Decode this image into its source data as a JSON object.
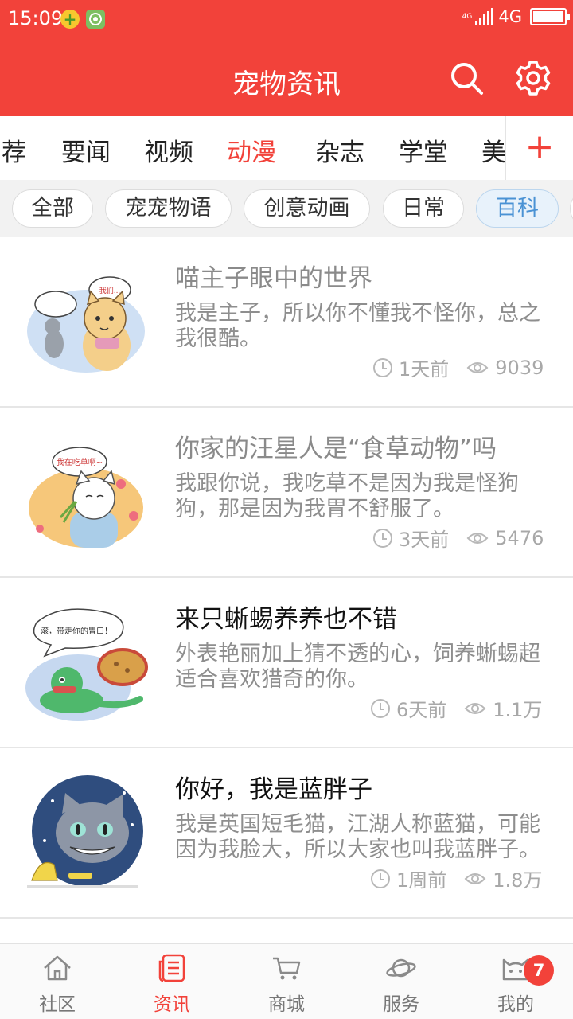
{
  "status_bar": {
    "time": "15:09",
    "network_small": "4G",
    "network": "4G"
  },
  "header": {
    "title": "宠物资讯",
    "icons": {
      "search": "search-icon",
      "settings": "gear-icon"
    }
  },
  "channels": {
    "items": [
      "荐",
      "要闻",
      "视频",
      "动漫",
      "杂志",
      "学堂",
      "美"
    ],
    "active": "动漫",
    "add_label": "+"
  },
  "subtabs": {
    "items": [
      "全部",
      "宠宠物语",
      "创意动画",
      "日常",
      "百科"
    ],
    "active": "百科"
  },
  "articles": [
    {
      "title": "喵主子眼中的世界",
      "desc": "我是主子，所以你不懂我不怪你，总之我很酷。",
      "time": "1天前",
      "views": "9039",
      "read": true,
      "image": "cartoon-cat-mouse"
    },
    {
      "title": "你家的汪星人是“食草动物”吗",
      "desc": "我跟你说，我吃草不是因为我是怪狗狗，那是因为我胃不舒服了。",
      "time": "3天前",
      "views": "5476",
      "read": true,
      "image": "cartoon-dog-eating-grass"
    },
    {
      "title": "来只蜥蜴养养也不错",
      "desc": "外表艳丽加上猜不透的心，饲养蜥蜴超适合喜欢猎奇的你。",
      "time": "6天前",
      "views": "1.1万",
      "read": false,
      "image": "cartoon-lizard"
    },
    {
      "title": "你好，我是蓝胖子",
      "desc": "我是英国短毛猫，江湖人称蓝猫，可能因为我脸大，所以大家也叫我蓝胖子。",
      "time": "1周前",
      "views": "1.8万",
      "read": false,
      "image": "cartoon-blue-cat"
    }
  ],
  "bottom_nav": {
    "items": [
      {
        "label": "社区",
        "icon": "home-icon"
      },
      {
        "label": "资讯",
        "icon": "news-icon"
      },
      {
        "label": "商城",
        "icon": "cart-icon"
      },
      {
        "label": "服务",
        "icon": "planet-icon"
      },
      {
        "label": "我的",
        "icon": "cat-face-icon"
      }
    ],
    "active": "资讯",
    "badge": "7"
  },
  "colors": {
    "brand": "#f2423a",
    "chip_active": "#4a92d4"
  }
}
